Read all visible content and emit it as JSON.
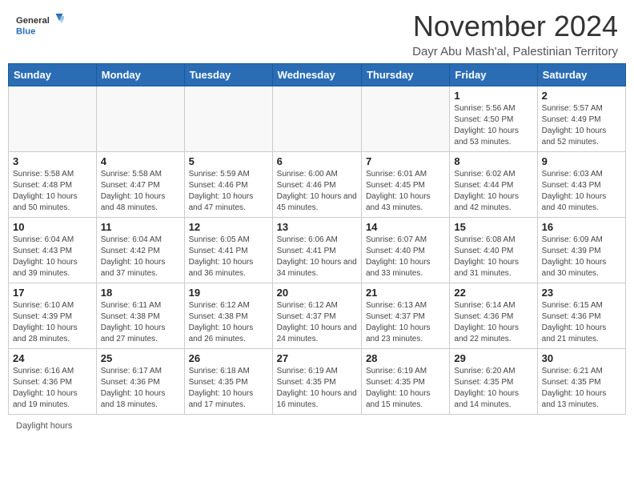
{
  "header": {
    "logo_line1": "General",
    "logo_line2": "Blue",
    "month_title": "November 2024",
    "location": "Dayr Abu Mash'al, Palestinian Territory"
  },
  "weekdays": [
    "Sunday",
    "Monday",
    "Tuesday",
    "Wednesday",
    "Thursday",
    "Friday",
    "Saturday"
  ],
  "weeks": [
    [
      {
        "day": "",
        "info": ""
      },
      {
        "day": "",
        "info": ""
      },
      {
        "day": "",
        "info": ""
      },
      {
        "day": "",
        "info": ""
      },
      {
        "day": "",
        "info": ""
      },
      {
        "day": "1",
        "info": "Sunrise: 5:56 AM\nSunset: 4:50 PM\nDaylight: 10 hours and 53 minutes."
      },
      {
        "day": "2",
        "info": "Sunrise: 5:57 AM\nSunset: 4:49 PM\nDaylight: 10 hours and 52 minutes."
      }
    ],
    [
      {
        "day": "3",
        "info": "Sunrise: 5:58 AM\nSunset: 4:48 PM\nDaylight: 10 hours and 50 minutes."
      },
      {
        "day": "4",
        "info": "Sunrise: 5:58 AM\nSunset: 4:47 PM\nDaylight: 10 hours and 48 minutes."
      },
      {
        "day": "5",
        "info": "Sunrise: 5:59 AM\nSunset: 4:46 PM\nDaylight: 10 hours and 47 minutes."
      },
      {
        "day": "6",
        "info": "Sunrise: 6:00 AM\nSunset: 4:46 PM\nDaylight: 10 hours and 45 minutes."
      },
      {
        "day": "7",
        "info": "Sunrise: 6:01 AM\nSunset: 4:45 PM\nDaylight: 10 hours and 43 minutes."
      },
      {
        "day": "8",
        "info": "Sunrise: 6:02 AM\nSunset: 4:44 PM\nDaylight: 10 hours and 42 minutes."
      },
      {
        "day": "9",
        "info": "Sunrise: 6:03 AM\nSunset: 4:43 PM\nDaylight: 10 hours and 40 minutes."
      }
    ],
    [
      {
        "day": "10",
        "info": "Sunrise: 6:04 AM\nSunset: 4:43 PM\nDaylight: 10 hours and 39 minutes."
      },
      {
        "day": "11",
        "info": "Sunrise: 6:04 AM\nSunset: 4:42 PM\nDaylight: 10 hours and 37 minutes."
      },
      {
        "day": "12",
        "info": "Sunrise: 6:05 AM\nSunset: 4:41 PM\nDaylight: 10 hours and 36 minutes."
      },
      {
        "day": "13",
        "info": "Sunrise: 6:06 AM\nSunset: 4:41 PM\nDaylight: 10 hours and 34 minutes."
      },
      {
        "day": "14",
        "info": "Sunrise: 6:07 AM\nSunset: 4:40 PM\nDaylight: 10 hours and 33 minutes."
      },
      {
        "day": "15",
        "info": "Sunrise: 6:08 AM\nSunset: 4:40 PM\nDaylight: 10 hours and 31 minutes."
      },
      {
        "day": "16",
        "info": "Sunrise: 6:09 AM\nSunset: 4:39 PM\nDaylight: 10 hours and 30 minutes."
      }
    ],
    [
      {
        "day": "17",
        "info": "Sunrise: 6:10 AM\nSunset: 4:39 PM\nDaylight: 10 hours and 28 minutes."
      },
      {
        "day": "18",
        "info": "Sunrise: 6:11 AM\nSunset: 4:38 PM\nDaylight: 10 hours and 27 minutes."
      },
      {
        "day": "19",
        "info": "Sunrise: 6:12 AM\nSunset: 4:38 PM\nDaylight: 10 hours and 26 minutes."
      },
      {
        "day": "20",
        "info": "Sunrise: 6:12 AM\nSunset: 4:37 PM\nDaylight: 10 hours and 24 minutes."
      },
      {
        "day": "21",
        "info": "Sunrise: 6:13 AM\nSunset: 4:37 PM\nDaylight: 10 hours and 23 minutes."
      },
      {
        "day": "22",
        "info": "Sunrise: 6:14 AM\nSunset: 4:36 PM\nDaylight: 10 hours and 22 minutes."
      },
      {
        "day": "23",
        "info": "Sunrise: 6:15 AM\nSunset: 4:36 PM\nDaylight: 10 hours and 21 minutes."
      }
    ],
    [
      {
        "day": "24",
        "info": "Sunrise: 6:16 AM\nSunset: 4:36 PM\nDaylight: 10 hours and 19 minutes."
      },
      {
        "day": "25",
        "info": "Sunrise: 6:17 AM\nSunset: 4:36 PM\nDaylight: 10 hours and 18 minutes."
      },
      {
        "day": "26",
        "info": "Sunrise: 6:18 AM\nSunset: 4:35 PM\nDaylight: 10 hours and 17 minutes."
      },
      {
        "day": "27",
        "info": "Sunrise: 6:19 AM\nSunset: 4:35 PM\nDaylight: 10 hours and 16 minutes."
      },
      {
        "day": "28",
        "info": "Sunrise: 6:19 AM\nSunset: 4:35 PM\nDaylight: 10 hours and 15 minutes."
      },
      {
        "day": "29",
        "info": "Sunrise: 6:20 AM\nSunset: 4:35 PM\nDaylight: 10 hours and 14 minutes."
      },
      {
        "day": "30",
        "info": "Sunrise: 6:21 AM\nSunset: 4:35 PM\nDaylight: 10 hours and 13 minutes."
      }
    ]
  ],
  "footer": {
    "daylight_label": "Daylight hours"
  }
}
